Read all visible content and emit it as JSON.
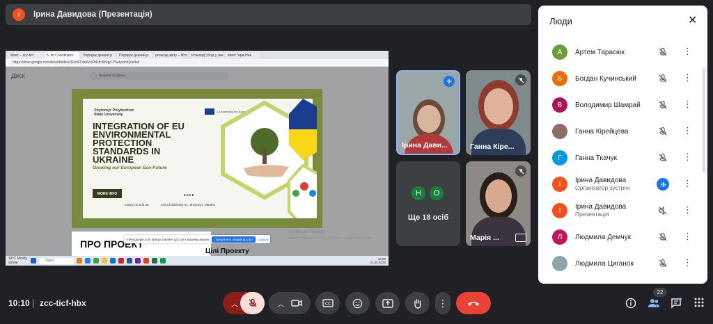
{
  "presenter_bar": {
    "avatar_letter": "І",
    "name": "Ірина Давидова (Презентація)"
  },
  "shared_screen": {
    "tabs": [
      "Меет – zcc-ticf",
      "5. Ist Coordinator",
      "Порядок денний р",
      "Порядок денний р",
      "розклад звіту – Жто",
      "Розклад | Бізд у зви",
      "Меет \"ири-Нее"
    ],
    "url": "https://drive.google.com/drive/folders/1RcMTxnnRUOtGfcW6qyCY5eIy4tnfQesdak",
    "drive_logo": "Диск",
    "drive_search": "Шукати на Диску",
    "poster": {
      "university": "Zhytomyr Polytechnic State University",
      "eu_label": "Co-funded by the European Union",
      "title": "INTEGRATION OF EU ENVIRONMENTAL PROTECTION STANDARDS IN UKRAINE",
      "subtitle": "Growing our European Eco-Future",
      "more_info": "MORE INFO",
      "site": "eueps.ztu.edu.ua",
      "address": "103 Chudnivska St., Zhytomyr, Ukraine"
    },
    "below_poster": {
      "heading": "ПРО ПРОЕКТ",
      "heading2": "Цілі Проекту"
    },
    "notification": {
      "text": "meet.google.com предоставляет доступ к вашему экрану",
      "button": "Прекратить общий доступ",
      "hide": "Скрыть"
    },
    "activation": {
      "line1": "Активация Windows",
      "line2": "Чтобы активировать Windows, перейдите в раздел \"Параметры\"."
    },
    "taskbar": {
      "weather_temp": "14°C",
      "weather_text": "Mostly sunny",
      "search": "Поиск",
      "time": "10:09",
      "date": "01.05.2025"
    }
  },
  "tiles": [
    {
      "name": "Ірина Дави...",
      "speaking": true
    },
    {
      "name": "Ганна Кіре...",
      "muted": true
    },
    {
      "more_text": "Ще 18 осіб",
      "avatars": [
        {
          "letter": "Н",
          "color": "#188038"
        },
        {
          "letter": "О",
          "color": "#188038"
        }
      ]
    },
    {
      "name": "Марія ...",
      "muted": true,
      "presenting": true
    }
  ],
  "people_panel": {
    "title": "Люди",
    "participants": [
      {
        "letter": "А",
        "color": "#689f38",
        "name": "Артем Тарасюк",
        "role": "",
        "state": "muted"
      },
      {
        "letter": "Б",
        "color": "#ef6c00",
        "name": "Богдан Кучинський",
        "role": "",
        "state": "muted"
      },
      {
        "letter": "В",
        "color": "#ad1457",
        "name": "Володимир Шамрай",
        "role": "",
        "state": "muted"
      },
      {
        "letter": "",
        "color": "#8d6e63",
        "name": "Ганна Кірейцева",
        "role": "",
        "state": "muted",
        "photo": true
      },
      {
        "letter": "Г",
        "color": "#039be5",
        "name": "Ганна Ткачук",
        "role": "",
        "state": "muted"
      },
      {
        "letter": "І",
        "color": "#f4511e",
        "name": "Ірина Давидова",
        "role": "Організатор зустрічі",
        "state": "speaking"
      },
      {
        "letter": "І",
        "color": "#f4511e",
        "name": "Ірина Давидова",
        "role": "Презентація",
        "state": "audio-off"
      },
      {
        "letter": "Л",
        "color": "#c2185b",
        "name": "Людмила Демчук",
        "role": "",
        "state": "muted"
      },
      {
        "letter": "",
        "color": "#90a4ae",
        "name": "Людмила Циганок",
        "role": "",
        "state": "muted",
        "photo": true
      }
    ]
  },
  "bottom_bar": {
    "time": "10:10",
    "meeting_code": "zcc-ticf-hbx",
    "people_count": "22"
  },
  "colors": {
    "end_call": "#ea4335",
    "mic_off": "#f9dedc",
    "mic_chevron": "#8c1d18",
    "accent": "#1a73e8"
  }
}
